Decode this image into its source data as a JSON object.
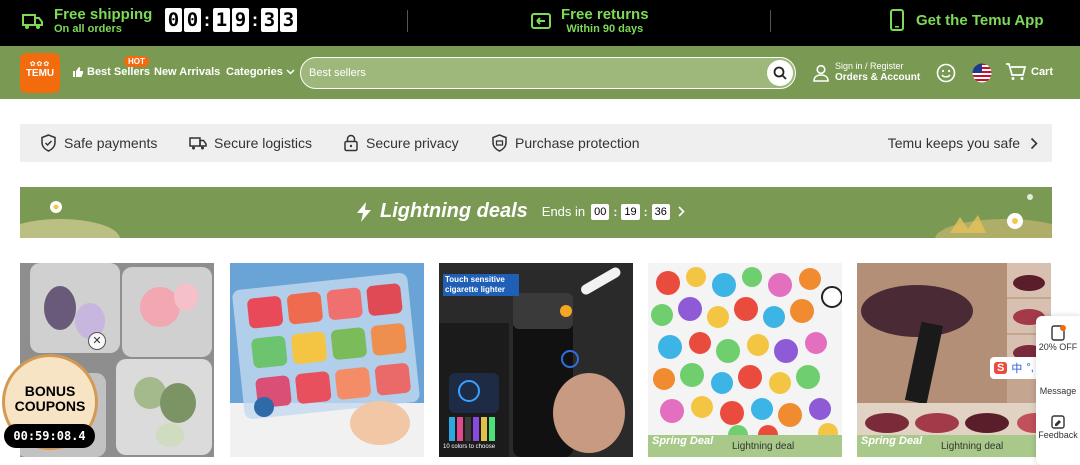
{
  "topbar": {
    "shipping_title": "Free shipping",
    "shipping_sub": "On all orders",
    "timer_digits": [
      "0",
      "0",
      "1",
      "9",
      "3",
      "3"
    ],
    "returns_title": "Free returns",
    "returns_sub": "Within 90 days",
    "app_label": "Get the Temu App"
  },
  "header": {
    "logo_text": "TEMU",
    "nav": {
      "best_sellers": "Best Sellers",
      "hot_badge": "HOT",
      "new_arrivals": "New Arrivals",
      "categories": "Categories"
    },
    "search_placeholder": "Best sellers",
    "account_line1": "Sign in / Register",
    "account_line2": "Orders & Account",
    "cart_label": "Cart"
  },
  "safety": {
    "items": [
      "Safe payments",
      "Secure logistics",
      "Secure privacy",
      "Purchase protection"
    ],
    "right_label": "Temu keeps you safe"
  },
  "lightning": {
    "title": "Lightning deals",
    "ends_in": "Ends in",
    "hh": "00",
    "mm": "19",
    "ss": "36"
  },
  "products": [
    {
      "tag": ""
    },
    {
      "tag": ""
    },
    {
      "tag": "",
      "overlay_text": "Touch sensitive cigarette lighter",
      "caption": "10 colors to choose"
    },
    {
      "tag": "Lightning deal",
      "badge": "Spring Deal"
    },
    {
      "tag": "Lightning deal",
      "badge": "Spring Deal"
    }
  ],
  "bonus": {
    "line1": "BONUS",
    "line2": "COUPONS",
    "timer": "00:59:08.4"
  },
  "side": {
    "offer": "20% OFF",
    "message": "Message",
    "feedback": "Feedback"
  },
  "ime": [
    "中",
    "°,",
    "☺",
    "⌨"
  ],
  "colors": {
    "accent_green": "#7ed957",
    "header_green": "#7a9a54",
    "brand_orange": "#f26b0d"
  }
}
